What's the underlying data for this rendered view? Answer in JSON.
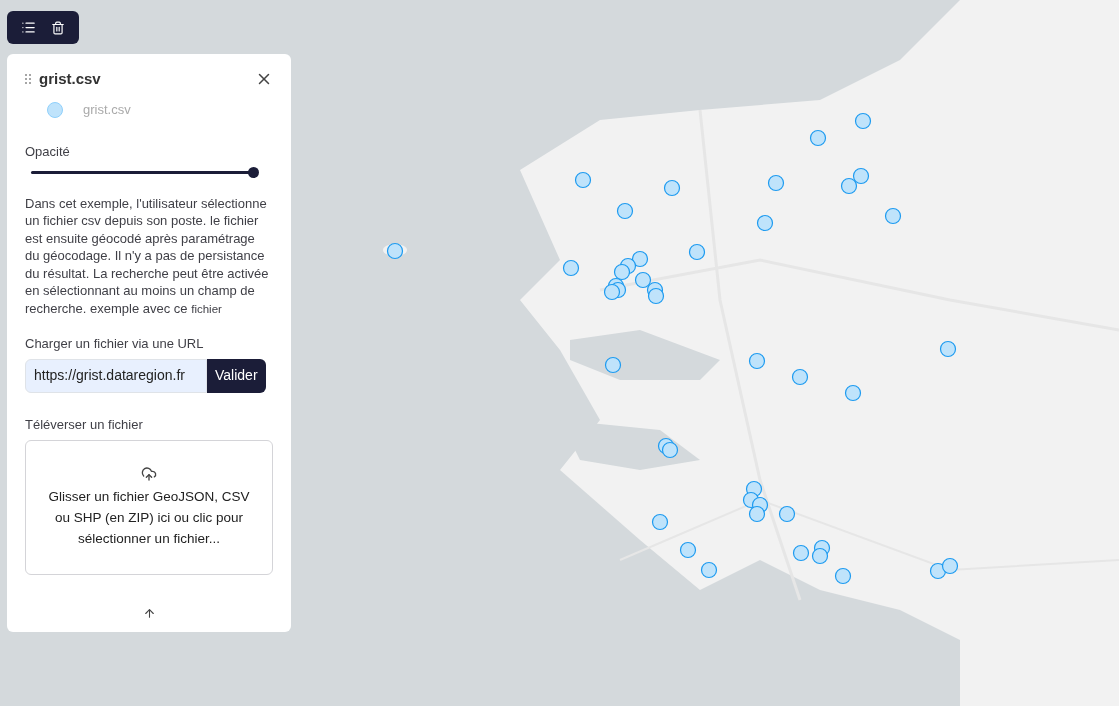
{
  "toolbar": {
    "buttons": [
      {
        "kind": "list"
      },
      {
        "kind": "delete"
      }
    ]
  },
  "layer_panel": {
    "title": "grist.csv",
    "legend": {
      "label": "grist.csv",
      "color": "#bfe3fb"
    },
    "opacity": {
      "label": "Opacité",
      "level": 1
    },
    "description": "Dans cet exemple, l'utilisateur sélectionne un fichier csv depuis son poste. le fichier est ensuite géocodé après paramétrage du géocodage. Il n'y a pas de persistance du résultat. La recherche peut être activée en sélectionnant au moins un champ de recherche. exemple avec ce",
    "description_link": "fichier",
    "url_loader": {
      "label": "Charger un fichier via une URL",
      "value": "https://grist.dataregion.fr",
      "button": "Valider"
    },
    "upload": {
      "label": "Téléverser un fichier",
      "text": "Glisser un fichier GeoJSON, CSV ou SHP (en ZIP) ici ou clic pour sélectionner un fichier..."
    }
  }
}
